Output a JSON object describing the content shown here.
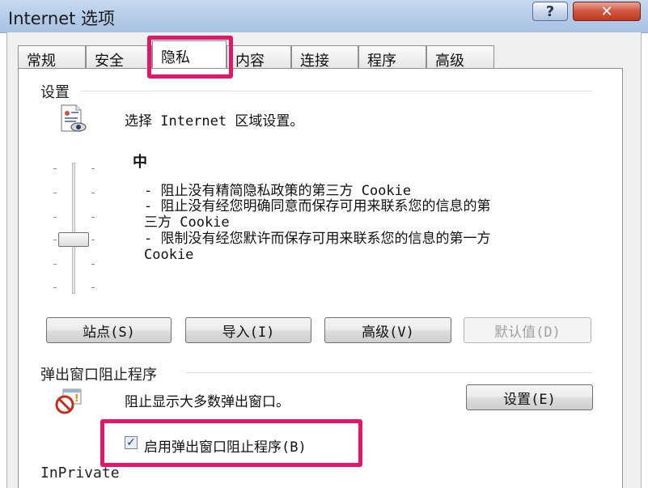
{
  "window": {
    "title": "Internet 选项",
    "help_label": "?",
    "close_label": "✕"
  },
  "tabs": [
    {
      "label": "常规"
    },
    {
      "label": "安全"
    },
    {
      "label": "隐私",
      "active": true
    },
    {
      "label": "内容"
    },
    {
      "label": "连接"
    },
    {
      "label": "程序"
    },
    {
      "label": "高级"
    }
  ],
  "settings": {
    "group_label": "设置",
    "zone_text": "选择 Internet 区域设置。",
    "level": "中",
    "description_lines": [
      "- 阻止没有精简隐私政策的第三方 Cookie",
      "- 阻止没有经您明确同意而保存可用来联系您的信息的第",
      "三方 Cookie",
      "- 限制没有经您默许而保存可用来联系您的信息的第一方",
      "Cookie"
    ],
    "buttons": {
      "sites": "站点(S)",
      "import": "导入(I)",
      "advanced": "高级(V)",
      "default": "默认值(D)"
    }
  },
  "popup_blocker": {
    "group_label": "弹出窗口阻止程序",
    "description": "阻止显示大多数弹出窗口。",
    "settings_button": "设置(E)",
    "enable_checkbox": {
      "label": "启用弹出窗口阻止程序(B)",
      "checked": true
    }
  },
  "inprivate": {
    "group_label": "InPrivate"
  },
  "colors": {
    "highlight": "#e3176a",
    "title_bar": "#b6cde9",
    "close_button": "#c0391f"
  }
}
